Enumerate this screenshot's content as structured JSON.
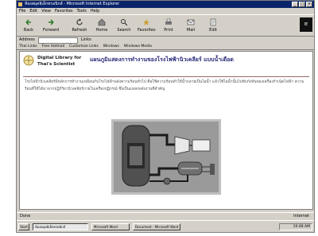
{
  "window": {
    "title": "ห้องสมุดอิเล็กทรอนิกส์ - Microsoft Internet Explorer",
    "buttons": [
      "_",
      "□",
      "×"
    ]
  },
  "menu": [
    "File",
    "Edit",
    "View",
    "Favorites",
    "Tools",
    "Help"
  ],
  "toolbar": {
    "buttons": [
      {
        "label": "Back",
        "icon": "back-arrow-icon"
      },
      {
        "label": "Forward",
        "icon": "forward-arrow-icon"
      },
      {
        "label": "Refresh",
        "icon": "refresh-icon"
      },
      {
        "label": "Home",
        "icon": "home-icon"
      },
      {
        "label": "Search",
        "icon": "search-icon"
      },
      {
        "label": "Favorites",
        "icon": "favorites-icon"
      },
      {
        "label": "Print",
        "icon": "print-icon"
      },
      {
        "label": "Mail",
        "icon": "mail-icon"
      },
      {
        "label": "Edit",
        "icon": "edit-icon"
      }
    ],
    "brand": "IE"
  },
  "address": {
    "label": "Address",
    "links_label": "Links"
  },
  "links": [
    "Thai Links",
    "Free Hotmail",
    "Customize Links",
    "Windows",
    "Windows Media"
  ],
  "page": {
    "library_name_line1": "Digital Library for",
    "library_name_line2": "Thai's Scientist",
    "title": "แผนภูมิแสดงการทำงานของโรงไฟฟ้านิวเคลียร์ แบบน้ำเดือด",
    "body": "โรงไฟฟ้านิวเคลียร์มีหลักการทำงานเหมือนกับโรงไฟฟ้าพลังความร้อนทั่วไป คือใช้ความร้อนทำให้น้ำกลายเป็นไอน้ำ แล้วใช้ไอน้ำนั้นไปขับกังหันของเครื่องกำเนิดไฟฟ้า ความร้อนที่ใช้ได้มาจากปฏิกิริยานิวเคลียร์ภายในเครื่องปฏิกรณ์ ซึ่งเป็นแหล่งพลังงานที่สำคัญ"
  },
  "status": {
    "left": "Done",
    "middle": "",
    "right": "Internet"
  },
  "taskbar": {
    "start": "Start",
    "items": [
      "ห้องสมุดอิเล็กทรอนิกส์",
      "Microsoft Word",
      "Document - Microsoft Word"
    ],
    "time": "10:48 AM"
  },
  "colors": {
    "titlebar": "#0a246a",
    "chrome": "#d4d0c8",
    "title_text": "#2a2a7a"
  }
}
